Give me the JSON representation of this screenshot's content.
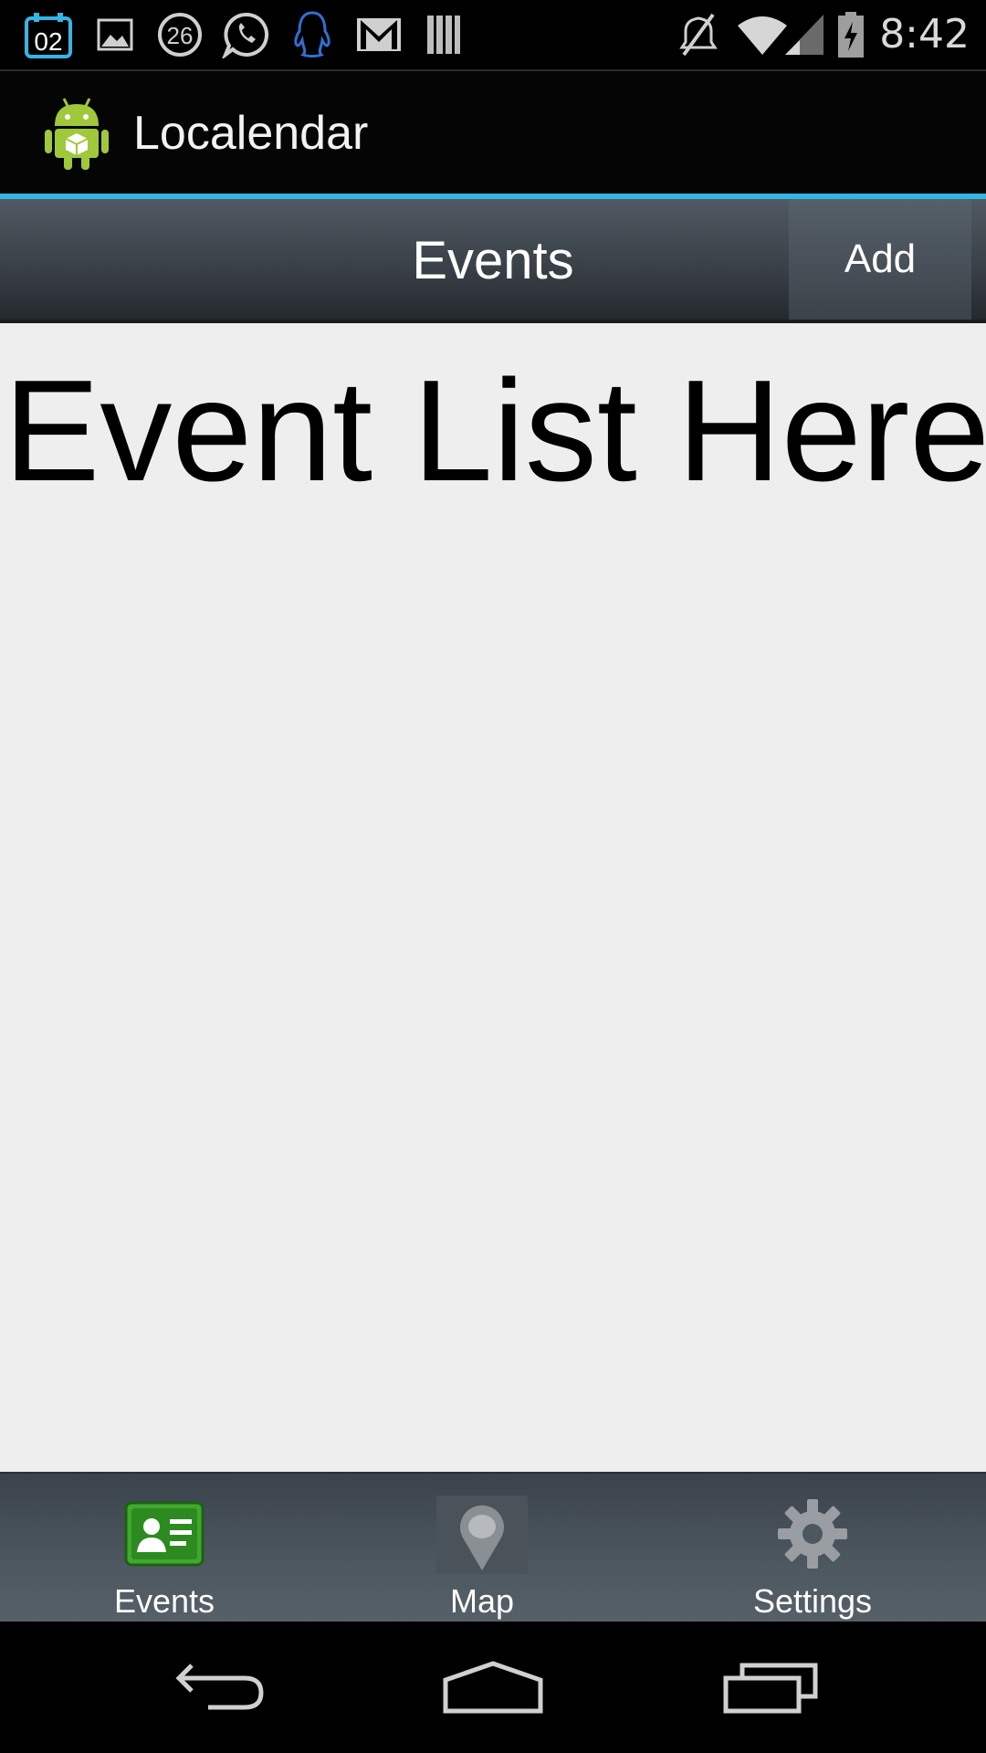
{
  "status_bar": {
    "time": "8:42",
    "calendar_badge": "02",
    "notification_count": "26",
    "icons": [
      "calendar-icon",
      "gallery-icon",
      "count-badge-icon",
      "whatsapp-icon",
      "qq-icon",
      "gmail-icon",
      "barcode-icon",
      "mute-icon",
      "wifi-icon",
      "signal-icon",
      "battery-charging-icon"
    ]
  },
  "action_bar": {
    "app_title": "Localendar",
    "app_icon": "android-icon",
    "accent_color": "#33b5e5"
  },
  "sub_toolbar": {
    "title": "Events",
    "add_label": "Add"
  },
  "content": {
    "text": "Event List Here"
  },
  "tabs": [
    {
      "label": "Events",
      "icon": "events-card-icon",
      "selected": true
    },
    {
      "label": "Map",
      "icon": "map-pin-icon",
      "selected": false
    },
    {
      "label": "Settings",
      "icon": "gear-icon",
      "selected": false
    }
  ],
  "nav_bar": {
    "icons": [
      "back-icon",
      "home-icon",
      "recents-icon"
    ]
  }
}
